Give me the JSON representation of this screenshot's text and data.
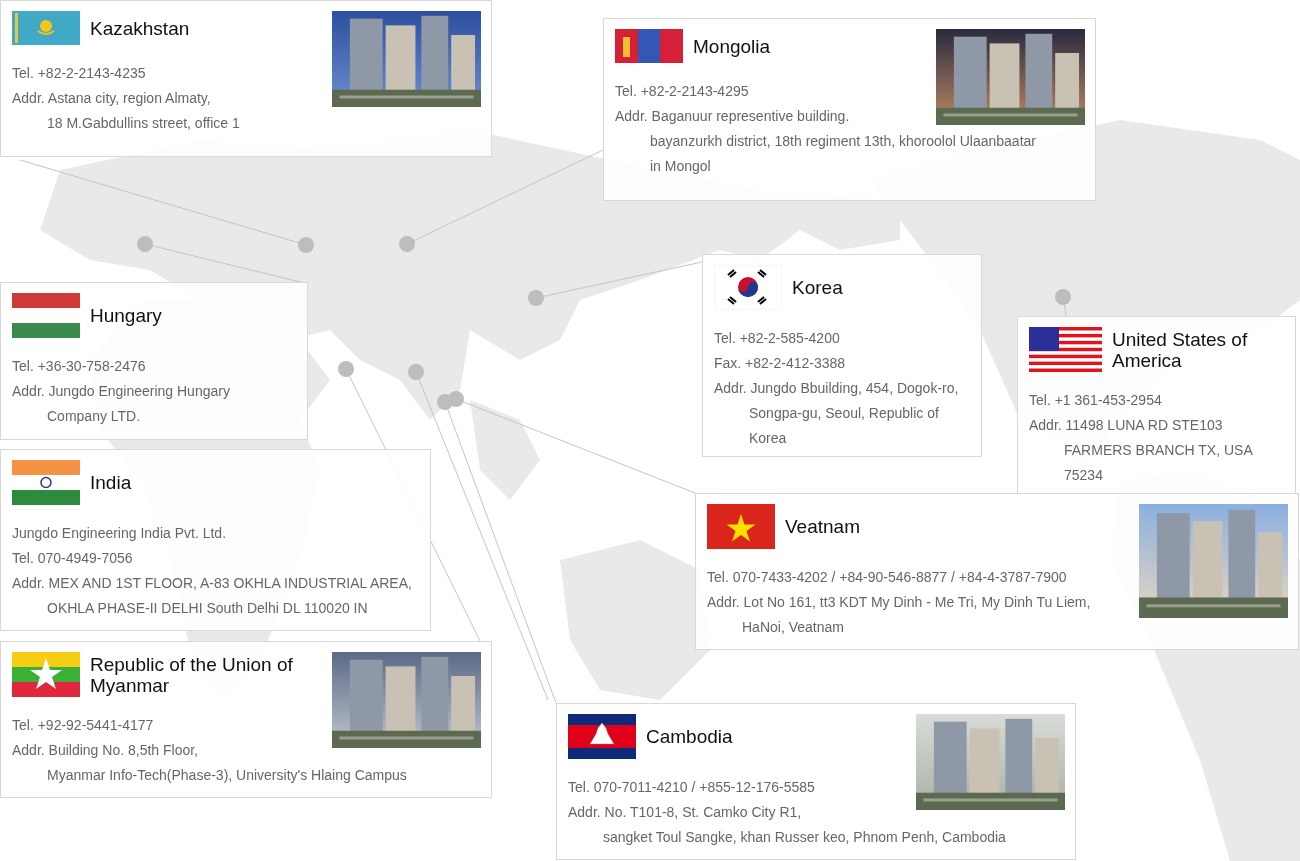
{
  "offices": [
    {
      "country": "Kazakhstan",
      "photo": {
        "kind": "picture"
      },
      "lines": [
        {
          "kind": "line",
          "text": "Tel. +82-2-2143-4235"
        },
        {
          "kind": "line",
          "text": "Addr. Astana city, region Almaty,"
        },
        {
          "kind": "indent",
          "text": "18 M.Gabdullins street, office 1"
        }
      ]
    },
    {
      "country": "Mongolia",
      "photo": {
        "kind": "picture"
      },
      "lines": [
        {
          "kind": "line",
          "text": "Tel. +82-2-2143-4295"
        },
        {
          "kind": "line",
          "text": "Addr. Baganuur representive building."
        },
        {
          "kind": "indent",
          "text": "bayanzurkh district, 18th regiment 13th, khoroolol Ulaanbaatar"
        },
        {
          "kind": "indent",
          "text": "in Mongol"
        }
      ]
    },
    {
      "country": "Hungary",
      "lines": [
        {
          "kind": "line",
          "text": "Tel. +36-30-758-2476"
        },
        {
          "kind": "line",
          "text": "Addr. Jungdo Engineering Hungary"
        },
        {
          "kind": "indent",
          "text": "Company LTD."
        }
      ]
    },
    {
      "country": "Korea",
      "lines": [
        {
          "kind": "line",
          "text": "Tel. +82-2-585-4200"
        },
        {
          "kind": "line",
          "text": "Fax. +82-2-412-3388"
        },
        {
          "kind": "line",
          "text": "Addr. Jungdo Bbuilding, 454, Dogok-ro,"
        },
        {
          "kind": "indent",
          "text": "Songpa-gu, Seoul, Republic of"
        },
        {
          "kind": "indent",
          "text": "Korea"
        }
      ]
    },
    {
      "country": "United States of America",
      "lines": [
        {
          "kind": "line",
          "text": "Tel. +1 361-453-2954"
        },
        {
          "kind": "line",
          "text": "Addr. 11498 LUNA RD STE103"
        },
        {
          "kind": "indent",
          "text": "FARMERS BRANCH TX, USA"
        },
        {
          "kind": "indent",
          "text": "75234"
        }
      ]
    },
    {
      "country": "India",
      "lines": [
        {
          "kind": "line",
          "text": "Jungdo Engineering India Pvt. Ltd."
        },
        {
          "kind": "line",
          "text": "Tel. 070-4949-7056"
        },
        {
          "kind": "line",
          "text": "Addr. MEX AND 1ST FLOOR, A-83 OKHLA INDUSTRIAL AREA,"
        },
        {
          "kind": "indent",
          "text": "OKHLA PHASE-II DELHI South Delhi DL 110020 IN"
        }
      ]
    },
    {
      "country": "Veatnam",
      "photo": {
        "kind": "picture"
      },
      "lines": [
        {
          "kind": "line",
          "text": "Tel. 070-7433-4202 / +84-90-546-8877 / +84-4-3787-7900"
        },
        {
          "kind": "line",
          "text": "Addr. Lot No 161, tt3 KDT My Dinh - Me Tri, My Dinh Tu Liem,"
        },
        {
          "kind": "indent",
          "text": "HaNoi, Veatnam"
        }
      ]
    },
    {
      "country": "Republic of the Union of Myanmar",
      "photo": {
        "kind": "picture"
      },
      "lines": [
        {
          "kind": "line",
          "text": "Tel. +92-92-5441-4177"
        },
        {
          "kind": "line",
          "text": "Addr. Building No. 8,5th Floor,"
        },
        {
          "kind": "indent",
          "text": "Myanmar Info-Tech(Phase-3), University's Hlaing Campus"
        }
      ]
    },
    {
      "country": "Cambodia",
      "photo": {
        "kind": "picture"
      },
      "lines": [
        {
          "kind": "line",
          "text": "Tel. 070-7011-4210 / +855-12-176-5585"
        },
        {
          "kind": "line",
          "text": "Addr. No. T101-8, St. Camko City R1,"
        },
        {
          "kind": "indent",
          "text": "sangket Toul Sangke, khan Russer keo, Phnom Penh, Cambodia"
        }
      ]
    }
  ]
}
